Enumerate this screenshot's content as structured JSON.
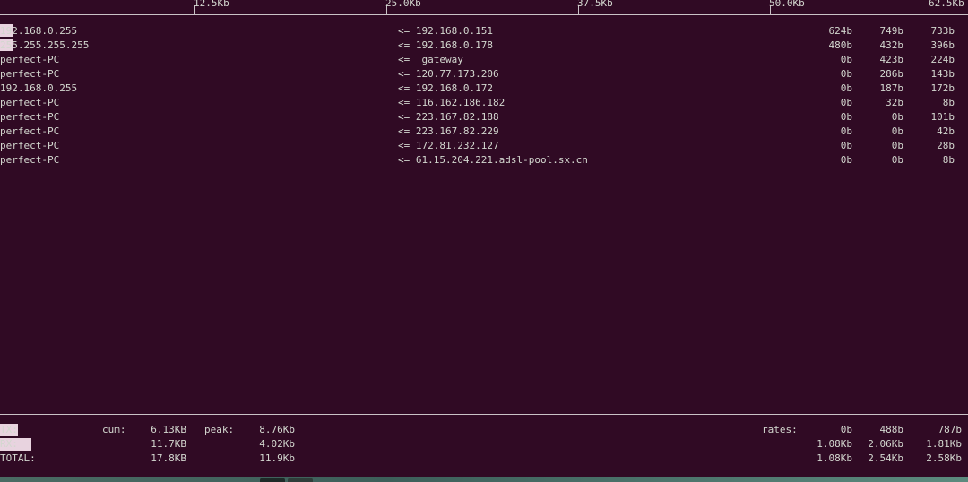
{
  "scale": {
    "ticks": [
      "12.5Kb",
      "25.0Kb",
      "37.5Kb",
      "50.0Kb",
      "62.5Kb"
    ]
  },
  "connections": [
    {
      "src": "192.168.0.255",
      "dir": "<=",
      "dst": "192.168.0.151",
      "r1": "624b",
      "r2": "749b",
      "r3": "733b"
    },
    {
      "src": "255.255.255.255",
      "dir": "<=",
      "dst": "192.168.0.178",
      "r1": "480b",
      "r2": "432b",
      "r3": "396b"
    },
    {
      "src": "perfect-PC",
      "dir": "<=",
      "dst": "_gateway",
      "r1": "0b",
      "r2": "423b",
      "r3": "224b"
    },
    {
      "src": "perfect-PC",
      "dir": "<=",
      "dst": "120.77.173.206",
      "r1": "0b",
      "r2": "286b",
      "r3": "143b"
    },
    {
      "src": "192.168.0.255",
      "dir": "<=",
      "dst": "192.168.0.172",
      "r1": "0b",
      "r2": "187b",
      "r3": "172b"
    },
    {
      "src": "perfect-PC",
      "dir": "<=",
      "dst": "116.162.186.182",
      "r1": "0b",
      "r2": "32b",
      "r3": "8b"
    },
    {
      "src": "perfect-PC",
      "dir": "<=",
      "dst": "223.167.82.188",
      "r1": "0b",
      "r2": "0b",
      "r3": "101b"
    },
    {
      "src": "perfect-PC",
      "dir": "<=",
      "dst": "223.167.82.229",
      "r1": "0b",
      "r2": "0b",
      "r3": "42b"
    },
    {
      "src": "perfect-PC",
      "dir": "<=",
      "dst": "172.81.232.127",
      "r1": "0b",
      "r2": "0b",
      "r3": "28b"
    },
    {
      "src": "perfect-PC",
      "dir": "<=",
      "dst": "61.15.204.221.adsl-pool.sx.cn",
      "r1": "0b",
      "r2": "0b",
      "r3": "8b"
    }
  ],
  "footer": {
    "cum_label": "cum:",
    "peak_label": "peak:",
    "rates_label": "rates:",
    "tx": {
      "label": "TX:",
      "cum": "6.13KB",
      "peak": "8.76Kb",
      "r1": "0b",
      "r2": "488b",
      "r3": "787b"
    },
    "rx": {
      "label": "RX:",
      "cum": "11.7KB",
      "peak": "4.02Kb",
      "r1": "1.08Kb",
      "r2": "2.06Kb",
      "r3": "1.81Kb"
    },
    "total": {
      "label": "TOTAL:",
      "cum": "17.8KB",
      "peak": "11.9Kb",
      "r1": "1.08Kb",
      "r2": "2.54Kb",
      "r3": "2.58Kb"
    }
  }
}
